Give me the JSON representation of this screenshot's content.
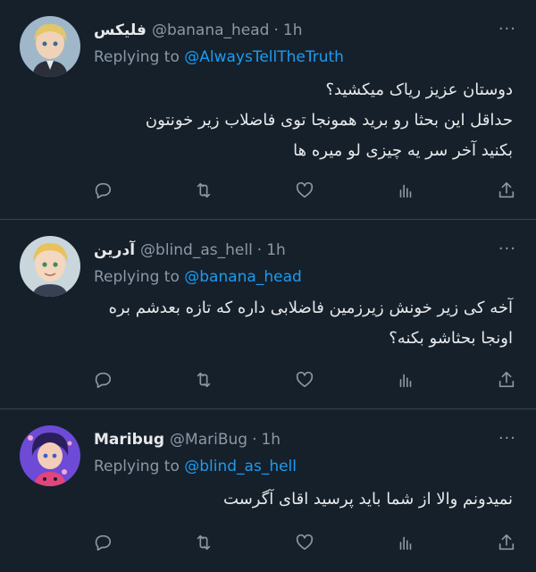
{
  "tweets": [
    {
      "name": "فلیکس",
      "handle": "@banana_head",
      "time": "1h",
      "replying_prefix": "Replying to ",
      "replying_to": "@AlwaysTellTheTruth",
      "lines": [
        "دوستان عزیز ریاک میکشید؟",
        "حداقل این بحثا رو برید همونجا توی فاضلاب زیر خونتون",
        "بکنید آخر سر یه چیزی لو میره ها"
      ],
      "avatar_colors": {
        "bg": "#9fb7c9",
        "hair": "#e2c66a",
        "skin": "#f0d2b8",
        "suit": "#2a2f3a"
      }
    },
    {
      "name": "آدرین",
      "handle": "@blind_as_hell",
      "time": "1h",
      "replying_prefix": "Replying to ",
      "replying_to": "@banana_head",
      "lines": [
        "آخه کی زیر خونش زیرزمین فاضلابی داره که تازه بعدشم بره",
        "اونجا بحثاشو بکنه؟"
      ],
      "avatar_colors": {
        "bg": "#c9d6dc",
        "hair": "#e8c25a",
        "skin": "#f3d7bf",
        "suit": "#394052"
      }
    },
    {
      "name": "Maribug",
      "handle": "@MariBug",
      "time": "1h",
      "replying_prefix": "Replying to ",
      "replying_to": "@blind_as_hell",
      "lines": [
        "نمیدونم والا از شما باید پرسید اقای آگرست"
      ],
      "avatar_colors": {
        "bg": "#6d4bd6",
        "hair": "#2a1f5a",
        "skin": "#f4cdb8",
        "suit": "#e0457b"
      }
    }
  ],
  "icons": {
    "reply": "reply-icon",
    "retweet": "retweet-icon",
    "like": "heart-icon",
    "views": "analytics-icon",
    "share": "share-icon",
    "more": "more-icon"
  },
  "more_glyph": "···"
}
